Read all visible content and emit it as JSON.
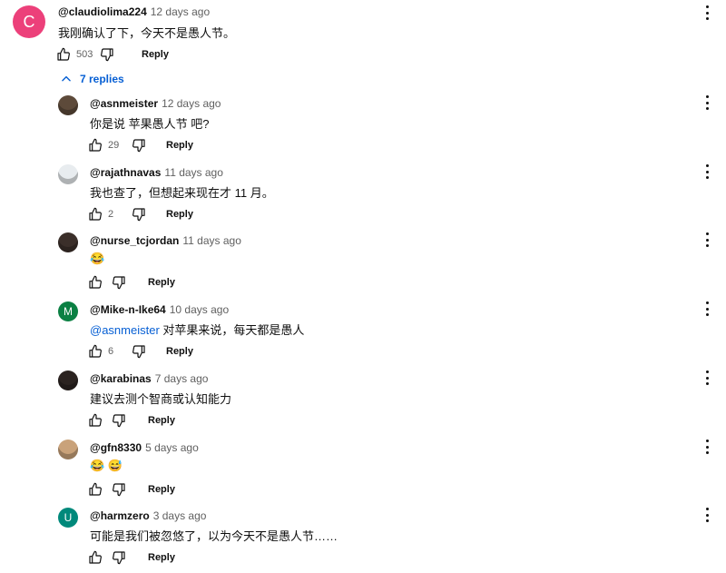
{
  "top_comment": {
    "avatar_letter": "C",
    "avatar_color": "#ec407a",
    "author": "@claudiolima224",
    "time": "12 days ago",
    "text": "我刚确认了下，今天不是愚人节。",
    "likes": "503",
    "reply_label": "Reply"
  },
  "replies_toggle": {
    "label": "7 replies"
  },
  "replies": [
    {
      "author": "@asnmeister",
      "time": "12 days ago",
      "text": "你是说 苹果愚人节 吧?",
      "likes": "29",
      "reply_label": "Reply",
      "avatar_type": "photo",
      "avatar_color": "#5d4a3a"
    },
    {
      "author": "@rajathnavas",
      "time": "11 days ago",
      "text": "我也查了，但想起来现在才 11 月。",
      "likes": "2",
      "reply_label": "Reply",
      "avatar_type": "photo",
      "avatar_color": "#e8ecef"
    },
    {
      "author": "@nurse_tcjordan",
      "time": "11 days ago",
      "text": "😂",
      "likes": "",
      "reply_label": "Reply",
      "avatar_type": "photo",
      "avatar_color": "#3b2f2a"
    },
    {
      "author": "@Mike-n-Ike64",
      "time": "10 days ago",
      "mention": "@asnmeister",
      "text": " 对苹果来说，每天都是愚人",
      "likes": "6",
      "reply_label": "Reply",
      "avatar_type": "letter",
      "avatar_letter": "M",
      "avatar_color": "#0b8043"
    },
    {
      "author": "@karabinas",
      "time": "7 days ago",
      "text": "建议去测个智商或认知能力",
      "likes": "",
      "reply_label": "Reply",
      "avatar_type": "photo",
      "avatar_color": "#2b2320"
    },
    {
      "author": "@gfn8330",
      "time": "5 days ago",
      "text": "😂 😅",
      "likes": "",
      "reply_label": "Reply",
      "avatar_type": "photo",
      "avatar_color": "#c9a27a"
    },
    {
      "author": "@harmzero",
      "time": "3 days ago",
      "text": "可能是我们被忽悠了，以为今天不是愚人节……",
      "likes": "",
      "reply_label": "Reply",
      "avatar_type": "letter",
      "avatar_letter": "U",
      "avatar_color": "#00897b"
    }
  ]
}
